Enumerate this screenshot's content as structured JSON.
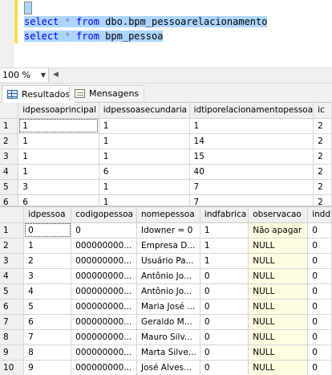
{
  "editor": {
    "lines": [
      {
        "kw1": "select",
        "star": " * ",
        "kw2": "from",
        "obj": " dbo.bpm_pessoarelacionamento"
      },
      {
        "kw1": "select",
        "star": " * ",
        "kw2": "from",
        "obj": " bpm_pessoa"
      }
    ]
  },
  "zoom": {
    "value": "100 %"
  },
  "tabs": [
    {
      "label": "Resultados",
      "icon": "grid-icon"
    },
    {
      "label": "Mensagens",
      "icon": "message-icon"
    }
  ],
  "grid1": {
    "columns": [
      "idpessoaprincipal",
      "idpessoasecundaria",
      "idtiporelacionamentopessoa",
      "ic"
    ],
    "rows": [
      {
        "n": "1",
        "c": [
          "1",
          "1",
          "1",
          "2"
        ]
      },
      {
        "n": "2",
        "c": [
          "1",
          "1",
          "14",
          "2"
        ]
      },
      {
        "n": "3",
        "c": [
          "1",
          "1",
          "15",
          "2"
        ]
      },
      {
        "n": "4",
        "c": [
          "1",
          "6",
          "40",
          "2"
        ]
      },
      {
        "n": "5",
        "c": [
          "3",
          "1",
          "7",
          "2"
        ]
      },
      {
        "n": "6",
        "c": [
          "6",
          "1",
          "7",
          "2"
        ]
      }
    ]
  },
  "grid2": {
    "columns": [
      "idpessoa",
      "codigopessoa",
      "nomepessoa",
      "indfabrica",
      "observacao",
      "indd"
    ],
    "rows": [
      {
        "n": "1",
        "c": [
          "0",
          "0",
          "Idowner = 0",
          "1",
          "Não apagar",
          "0"
        ]
      },
      {
        "n": "2",
        "c": [
          "1",
          "000000000...",
          "Empresa D...",
          "1",
          "NULL",
          "0"
        ]
      },
      {
        "n": "3",
        "c": [
          "2",
          "000000000...",
          "Usuário Pa...",
          "1",
          "NULL",
          "0"
        ]
      },
      {
        "n": "4",
        "c": [
          "3",
          "000000000...",
          "Antônio Jo...",
          "0",
          "NULL",
          "0"
        ]
      },
      {
        "n": "5",
        "c": [
          "4",
          "000000000...",
          "Antônio Jo...",
          "0",
          "NULL",
          "0"
        ]
      },
      {
        "n": "6",
        "c": [
          "5",
          "000000000...",
          "Maria José ...",
          "0",
          "NULL",
          "0"
        ]
      },
      {
        "n": "7",
        "c": [
          "6",
          "000000000...",
          "Geraldo M...",
          "0",
          "NULL",
          "0"
        ]
      },
      {
        "n": "8",
        "c": [
          "7",
          "000000000...",
          "Mauro Silv...",
          "0",
          "NULL",
          "0"
        ]
      },
      {
        "n": "9",
        "c": [
          "8",
          "000000000...",
          "Marta Silve...",
          "0",
          "NULL",
          "0"
        ]
      },
      {
        "n": "10",
        "c": [
          "9",
          "000000000...",
          "José Alves...",
          "0",
          "NULL",
          "0"
        ]
      }
    ]
  },
  "colors": {
    "keyword": "#0000ff",
    "selection": "#add6ff",
    "null_cell_bg": "#fffde0"
  }
}
